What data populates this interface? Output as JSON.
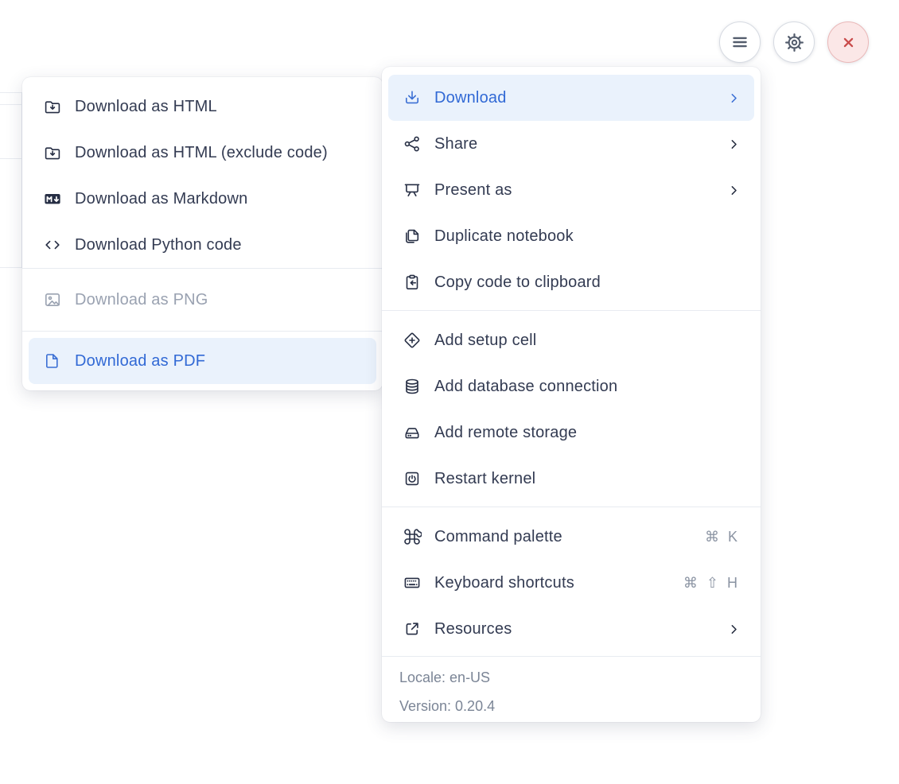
{
  "colors": {
    "accent": "#3169d5",
    "accent_highlight_bg": "#eaf2fc",
    "danger": "#c94c4c",
    "danger_bg": "#fbe7e7",
    "text": "#333b52",
    "disabled_text": "#9aa2b1",
    "footer_text": "#7b8596"
  },
  "topbar": {
    "buttons": [
      {
        "id": "menu",
        "icon": "hamburger-icon"
      },
      {
        "id": "settings",
        "icon": "gear-icon"
      },
      {
        "id": "close",
        "icon": "close-icon"
      }
    ]
  },
  "download_submenu": {
    "sections": [
      {
        "items": [
          {
            "label": "Download as HTML",
            "icon": "folder-download-icon"
          },
          {
            "label": "Download as HTML (exclude code)",
            "icon": "folder-download-icon"
          },
          {
            "label": "Download as Markdown",
            "icon": "markdown-icon"
          },
          {
            "label": "Download Python code",
            "icon": "code-icon"
          }
        ]
      },
      {
        "items": [
          {
            "label": "Download as PNG",
            "icon": "image-icon",
            "state": "disabled"
          }
        ]
      },
      {
        "items": [
          {
            "label": "Download as PDF",
            "icon": "file-icon",
            "state": "highlighted"
          }
        ]
      }
    ]
  },
  "main_menu": {
    "sections": [
      {
        "items": [
          {
            "label": "Download",
            "icon": "download-icon",
            "chevron": true,
            "state": "highlighted"
          },
          {
            "label": "Share",
            "icon": "share-icon",
            "chevron": true
          },
          {
            "label": "Present as",
            "icon": "presentation-icon",
            "chevron": true
          },
          {
            "label": "Duplicate notebook",
            "icon": "duplicate-icon"
          },
          {
            "label": "Copy code to clipboard",
            "icon": "clipboard-icon"
          }
        ]
      },
      {
        "items": [
          {
            "label": "Add setup cell",
            "icon": "diamond-plus-icon"
          },
          {
            "label": "Add database connection",
            "icon": "database-icon"
          },
          {
            "label": "Add remote storage",
            "icon": "storage-icon"
          },
          {
            "label": "Restart kernel",
            "icon": "restart-icon"
          }
        ]
      },
      {
        "items": [
          {
            "label": "Command palette",
            "icon": "command-icon",
            "shortcut": "⌘ K"
          },
          {
            "label": "Keyboard shortcuts",
            "icon": "keyboard-icon",
            "shortcut": "⌘ ⇧ H"
          },
          {
            "label": "Resources",
            "icon": "external-link-icon",
            "chevron": true
          }
        ]
      }
    ],
    "footer": {
      "locale": "Locale: en-US",
      "version": "Version: 0.20.4"
    }
  }
}
